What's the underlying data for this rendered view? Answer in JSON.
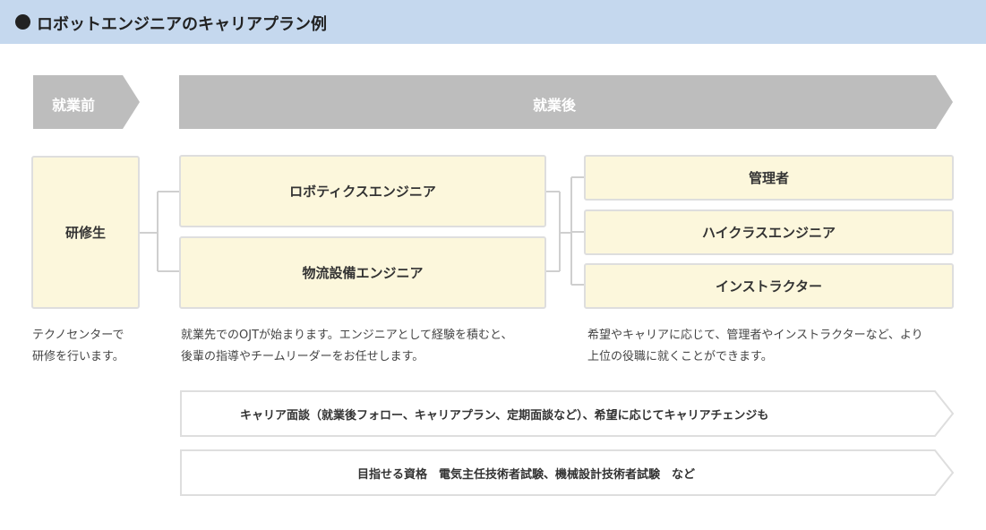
{
  "header": {
    "title": "ロボットエンジニアのキャリアプラン例",
    "bullet_icon": "filled-circle-bullet"
  },
  "phases": {
    "before": "就業前",
    "after": "就業後"
  },
  "boxes": {
    "trainee": "研修生",
    "robotics_engineer": "ロボティクスエンジニア",
    "logistics_engineer": "物流設備エンジニア",
    "manager": "管理者",
    "high_class_engineer": "ハイクラスエンジニア",
    "instructor": "インストラクター"
  },
  "descriptions": {
    "trainee": [
      "テクノセンターで",
      "研修を行います。"
    ],
    "engineers": [
      "就業先でのOJTが始まります。エンジニアとして経験を積むと、",
      "後輩の指導やチームリーダーをお任せします。"
    ],
    "advanced": [
      "希望やキャリアに応じて、管理者やインストラクターなど、より",
      "上位の役職に就くことができます。"
    ]
  },
  "banners": {
    "career_interview": "キャリア面談（就業後フォロー、キャリアプラン、定期面談など）、希望に応じてキャリアチェンジも",
    "qualifications": "目指せる資格　電気主任技術者試験、機械設計技術者試験　など"
  },
  "colors": {
    "header_bg": "#c5d8ee",
    "phase_arrow": "#bdbdbd",
    "box_fill": "#fcf7dc",
    "box_border": "#dedede"
  }
}
